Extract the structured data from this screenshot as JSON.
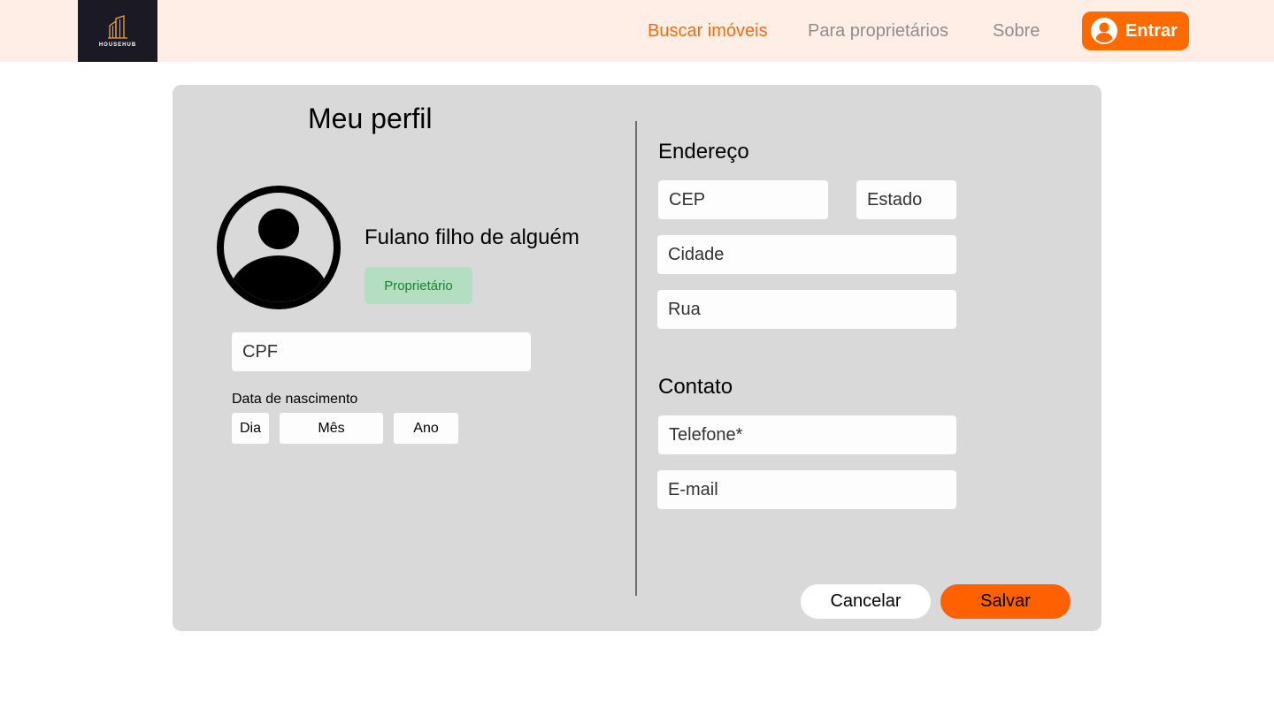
{
  "header": {
    "logo_text": "HOUSEHUB",
    "nav": [
      {
        "label": "Buscar imóveis",
        "active": true
      },
      {
        "label": "Para proprietários",
        "active": false
      },
      {
        "label": "Sobre",
        "active": false
      }
    ],
    "login_label": "Entrar",
    "login_icon": "user-circle-icon"
  },
  "profile": {
    "title": "Meu perfil",
    "avatar_icon": "user-avatar-icon",
    "name": "Fulano filho de alguém",
    "role_badge": "Proprietário",
    "cpf_placeholder": "CPF",
    "birth_label": "Data de nascimento",
    "birth_day": "Dia",
    "birth_month": "Mês",
    "birth_year": "Ano"
  },
  "address": {
    "title": "Endereço",
    "cep_placeholder": "CEP",
    "estado_placeholder": "Estado",
    "cidade_placeholder": "Cidade",
    "rua_placeholder": "Rua"
  },
  "contact": {
    "title": "Contato",
    "telefone_placeholder": "Telefone*",
    "email_placeholder": "E-mail"
  },
  "actions": {
    "cancel_label": "Cancelar",
    "save_label": "Salvar"
  },
  "colors": {
    "accent": "#FF6A00",
    "header_bg": "#FFEEE6",
    "card_bg": "#D9D9D9",
    "badge_bg": "#B3DEC1",
    "badge_text": "#17852F"
  }
}
